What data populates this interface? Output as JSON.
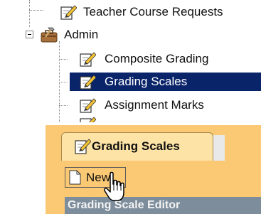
{
  "tree": {
    "items": [
      {
        "label": "Teacher Course Requests",
        "icon": "edit-pencil-icon"
      },
      {
        "label": "Admin",
        "icon": "admin-tools-icon"
      },
      {
        "label": "Composite Grading",
        "icon": "edit-pencil-icon"
      },
      {
        "label": "Grading Scales",
        "icon": "edit-pencil-icon",
        "selected": true
      },
      {
        "label": "Assignment Marks",
        "icon": "edit-pencil-icon"
      }
    ],
    "selection_color": "#0a246a"
  },
  "panel": {
    "tab_label": "Grading Scales",
    "tab_icon": "edit-pencil-icon",
    "new_label": "New",
    "new_icon": "new-document-icon",
    "editor_title": "Grading Scale Editor",
    "background_color": "#fbc874"
  },
  "cursor": "hand-pointer-icon"
}
